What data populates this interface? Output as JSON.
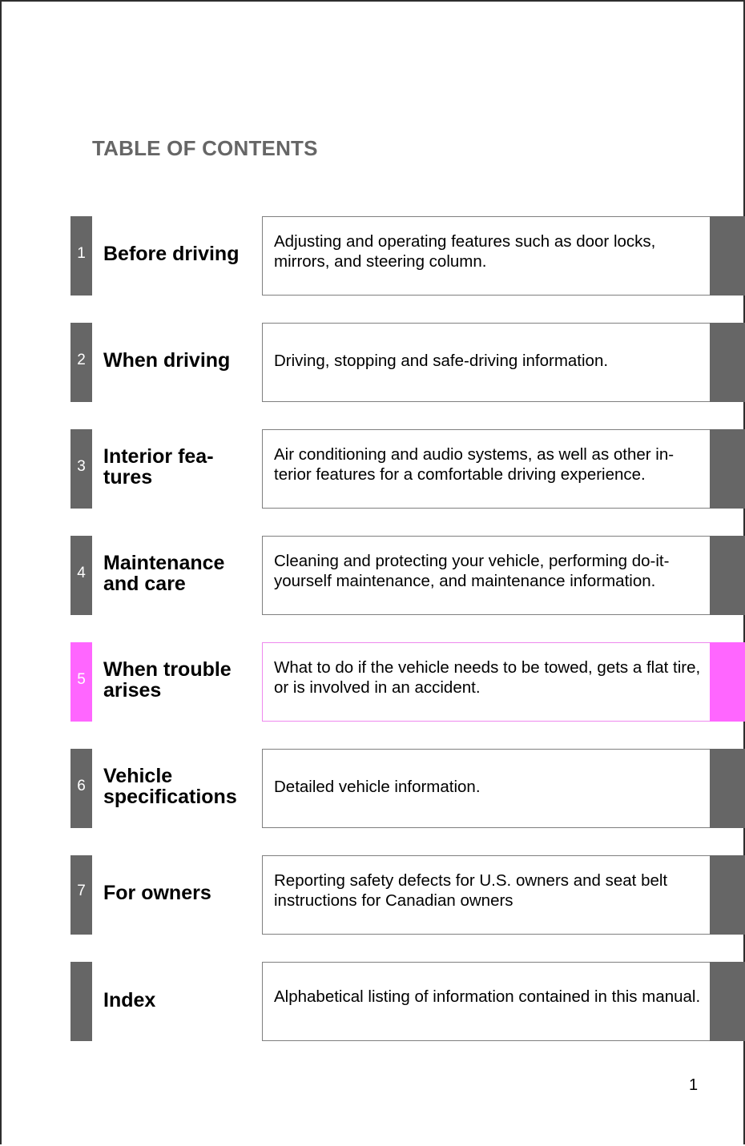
{
  "document": {
    "title": "TABLE OF CONTENTS",
    "page_number": "1",
    "colors": {
      "tab_default": "#666666",
      "tab_highlight": "#ff66ff",
      "title_gray": "#666666"
    }
  },
  "sections": [
    {
      "number": "1",
      "title": "Before driving",
      "description": "Adjusting and operating features such as door locks, mirrors, and steering column.",
      "highlighted": false
    },
    {
      "number": "2",
      "title": "When driving",
      "description": "Driving, stopping and safe-driving information.",
      "highlighted": false
    },
    {
      "number": "3",
      "title": "Interior fea- tures",
      "description": "Air conditioning and audio systems, as well as other in- terior features for a comfortable driving experience.",
      "highlighted": false
    },
    {
      "number": "4",
      "title": "Maintenance and care",
      "description": "Cleaning and protecting your vehicle, performing do-it-yourself maintenance, and maintenance information.",
      "highlighted": false
    },
    {
      "number": "5",
      "title": "When trouble arises",
      "description": "What to do if the vehicle needs to be towed, gets a flat tire, or is involved in an accident.",
      "highlighted": true
    },
    {
      "number": "6",
      "title": "Vehicle specifications",
      "description": "Detailed vehicle information.",
      "highlighted": false
    },
    {
      "number": "7",
      "title": "For owners",
      "description": "Reporting safety defects for U.S. owners and seat belt instructions for Canadian owners",
      "highlighted": false
    },
    {
      "number": "",
      "title": "Index",
      "description": "Alphabetical listing of information contained in this manual.",
      "highlighted": false
    }
  ]
}
